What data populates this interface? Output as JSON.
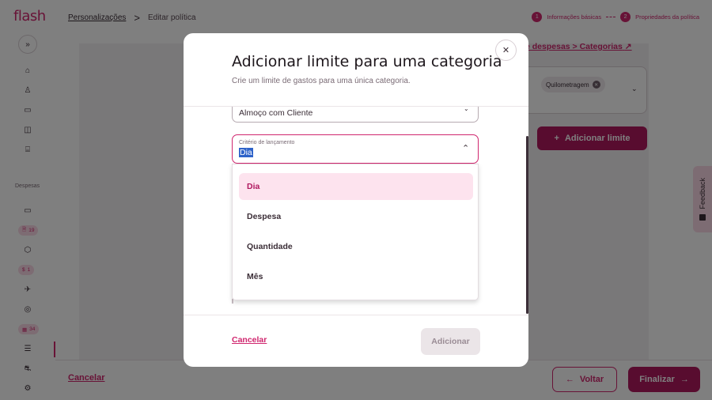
{
  "app": {
    "logo": "flash",
    "breadcrumb": [
      "Personalizações",
      "Editar política"
    ],
    "breadcrumb_sep": ">",
    "steps": [
      {
        "num": "1",
        "label": "Informações básicas"
      },
      {
        "num": "2",
        "label": "Propriedades da política"
      }
    ]
  },
  "sidebar": {
    "expand": "»",
    "section_label": "Despesas",
    "badges": [
      {
        "icon": "🗎",
        "count": "19"
      },
      {
        "icon": "$",
        "count": "1"
      },
      {
        "icon": "▦",
        "count": "34"
      }
    ]
  },
  "background": {
    "link": "e despesas > Categorias",
    "chip": "Quilometragem",
    "add_limit": "Adicionar limite",
    "cancel": "Cancelar",
    "back": "Voltar",
    "finish": "Finalizar",
    "feedback": "Feedback"
  },
  "modal": {
    "title": "Adicionar limite para uma categoria",
    "subtitle": "Crie um limite de gastos para uma única categoria.",
    "category_value": "Almoço com Cliente",
    "criteria_label": "Critério de lançamento",
    "criteria_value": "Dia",
    "options": [
      "Dia",
      "Despesa",
      "Quantidade",
      "Mês"
    ],
    "selected_option": "Dia",
    "cancel": "Cancelar",
    "add": "Adicionar"
  },
  "colors": {
    "brand": "#d0266e",
    "brand_dark": "#b0185f",
    "selected_bg": "#fde3ee"
  }
}
